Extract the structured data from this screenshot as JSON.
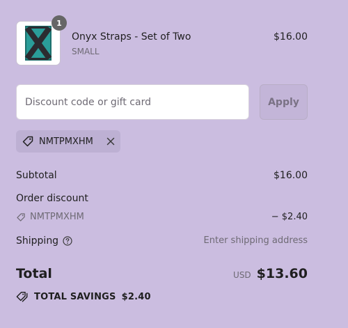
{
  "product": {
    "name": "Onyx Straps - Set of Two",
    "variant": "SMALL",
    "price": "$16.00",
    "quantity": "1"
  },
  "discount": {
    "placeholder": "Discount code or gift card",
    "apply_label": "Apply",
    "applied_code": "NMTPMXHM"
  },
  "summary": {
    "subtotal_label": "Subtotal",
    "subtotal_value": "$16.00",
    "order_discount_label": "Order discount",
    "discount_code": "NMTPMXHM",
    "discount_value": "− $2.40",
    "shipping_label": "Shipping",
    "shipping_value": "Enter shipping address",
    "total_label": "Total",
    "currency": "USD",
    "total_value": "$13.60",
    "savings_label": "TOTAL SAVINGS",
    "savings_value": "$2.40"
  }
}
